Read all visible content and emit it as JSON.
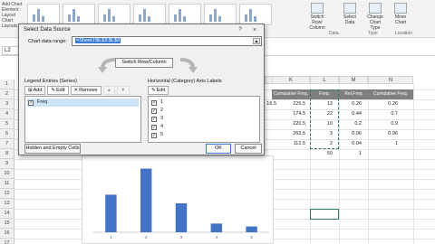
{
  "ribbon": {
    "left_labels": [
      "Add Chart",
      "Element",
      "Layout",
      "Chart Layouts"
    ],
    "groups": [
      {
        "label": "Switch Row/ Column",
        "icon": "switch-row-column-icon"
      },
      {
        "label": "Select Data",
        "icon": "select-data-icon"
      },
      {
        "label": "Change Chart Type",
        "icon": "change-chart-type-icon"
      },
      {
        "label": "Move Chart",
        "icon": "move-chart-icon"
      }
    ],
    "group_titles": {
      "data": "Data",
      "type": "Type",
      "location": "Location"
    }
  },
  "formula_bar": {
    "name_box": "L2"
  },
  "columns": [
    "J",
    "K",
    "L",
    "M",
    "N"
  ],
  "rows": [
    "1",
    "2",
    "3",
    "4",
    "5",
    "6",
    "7",
    "8",
    "9",
    "10",
    "11",
    "12",
    "13",
    "14",
    "15",
    "16",
    "17",
    "18"
  ],
  "table": {
    "headers": [
      "Cumulative Freq.",
      "Freq.",
      "Rel.Freq",
      "Cumulative Freq."
    ],
    "k_values": [
      "226.5",
      "174.5",
      "220.5",
      "262.5",
      "112.5",
      ""
    ],
    "j_values": [
      "16.5",
      "",
      "",
      "",
      "",
      ""
    ],
    "freq": [
      "13",
      "22",
      "10",
      "3",
      "2",
      "50"
    ],
    "rel_freq": [
      "0.26",
      "0.44",
      "0.2",
      "0.06",
      "0.04",
      "1"
    ],
    "cum_freq": [
      "0.26",
      "0.7",
      "0.9",
      "0.96",
      "1",
      ""
    ]
  },
  "dialog": {
    "title": "Select Data Source",
    "help": "?",
    "close": "×",
    "range_label": "Chart data range:",
    "range_value": "=Sheet1!$L$3:$L$8",
    "switch_label": "Switch Row/Column",
    "legend_title": "Legend Entries (Series)",
    "legend_buttons": {
      "add": "Add",
      "edit": "Edit",
      "remove": "Remove"
    },
    "series": [
      {
        "name": "Freq",
        "checked": true
      }
    ],
    "axis_title": "Horizontal (Category) Axis Labels",
    "axis_edit": "Edit",
    "categories": [
      {
        "label": "1",
        "checked": true
      },
      {
        "label": "2",
        "checked": true
      },
      {
        "label": "3",
        "checked": true
      },
      {
        "label": "4",
        "checked": true
      },
      {
        "label": "5",
        "checked": true
      }
    ],
    "hidden_cells": "Hidden and Empty Cells",
    "ok": "OK",
    "cancel": "Cancel"
  },
  "chart_data": {
    "type": "bar",
    "categories": [
      "1",
      "2",
      "3",
      "4",
      "5"
    ],
    "values": [
      13,
      22,
      10,
      3,
      2
    ],
    "ylim": [
      0,
      25
    ],
    "grid": false,
    "color": "#4472c4"
  },
  "colors": {
    "accent": "#3a7bd5",
    "header_bg": "#7f7f7f",
    "marquee": "#2e7d5b"
  }
}
